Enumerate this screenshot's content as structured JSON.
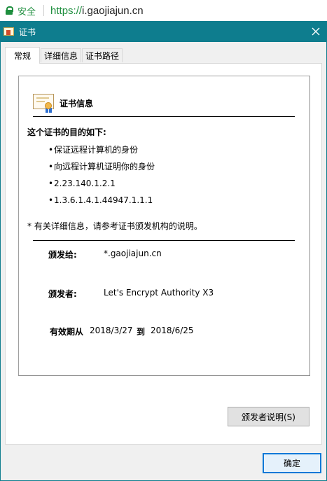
{
  "browser": {
    "secure_label": "安全",
    "url_scheme": "https://",
    "url_host": "i.gaojiajun.cn"
  },
  "dialog": {
    "title": "证书",
    "tabs": [
      {
        "label": "常规",
        "active": true
      },
      {
        "label": "详细信息",
        "active": false
      },
      {
        "label": "证书路径",
        "active": false
      }
    ],
    "general": {
      "heading": "证书信息",
      "purpose_title": "这个证书的目的如下:",
      "purposes": [
        "保证远程计算机的身份",
        "向远程计算机证明你的身份",
        "2.23.140.1.2.1",
        "1.3.6.1.4.1.44947.1.1.1"
      ],
      "note": "* 有关详细信息，请参考证书颁发机构的说明。",
      "issued_to_label": "颁发给:",
      "issued_to_value": "*.gaojiajun.cn",
      "issued_by_label": "颁发者:",
      "issued_by_value": "Let's Encrypt Authority X3",
      "validity_label": "有效期从",
      "valid_from": "2018/3/27",
      "to_label": "到",
      "valid_to": "2018/6/25"
    },
    "issuer_statement_button": "颁发者说明(S)",
    "ok_button": "确定"
  },
  "colors": {
    "titlebar": "#0e7d8e",
    "secure_green": "#1e8e3e",
    "default_button_border": "#0078d7"
  }
}
